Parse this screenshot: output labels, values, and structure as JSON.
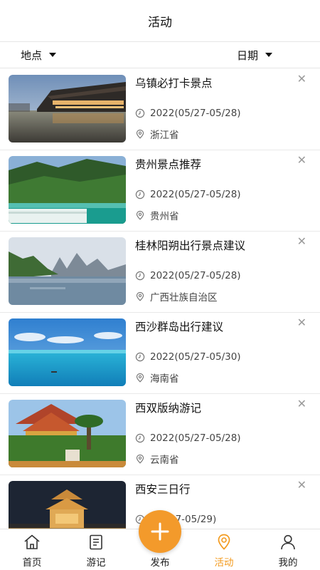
{
  "header": {
    "title": "活动"
  },
  "filters": {
    "location": "地点",
    "date": "日期"
  },
  "activities": [
    {
      "title": "乌镇必打卡景点",
      "date": "2022(05/27-05/28)",
      "location": "浙江省",
      "image": "water-town-photo"
    },
    {
      "title": "贵州景点推荐",
      "date": "2022(05/27-05/28)",
      "location": "贵州省",
      "image": "waterfall-forest-photo"
    },
    {
      "title": "桂林阳朔出行景点建议",
      "date": "2022(05/27-05/28)",
      "location": "广西壮族自治区",
      "image": "karst-river-photo"
    },
    {
      "title": "西沙群岛出行建议",
      "date": "2022(05/27-05/30)",
      "location": "海南省",
      "image": "ocean-sky-photo"
    },
    {
      "title": "西双版纳游记",
      "date": "2022(05/27-05/28)",
      "location": "云南省",
      "image": "temple-garden-photo"
    },
    {
      "title": "西安三日行",
      "date": "(05/27-05/29)",
      "location": "",
      "image": "bell-tower-night-photo"
    }
  ],
  "tabbar": {
    "home": "首页",
    "notes": "游记",
    "publish": "发布",
    "activity": "活动",
    "mine": "我的"
  },
  "icons": {
    "close": "close-icon",
    "clock": "clock-icon",
    "pin": "location-pin-icon",
    "plus": "plus-icon"
  },
  "colors": {
    "accent": "#f39a1d",
    "fab": "#f39a2b"
  }
}
